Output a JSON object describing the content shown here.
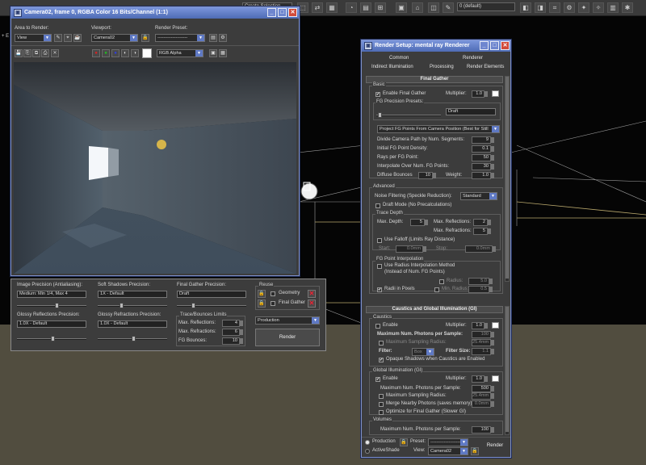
{
  "topbar": {
    "view_dropdown": "Create Selection",
    "layer_dropdown": "0 (default)"
  },
  "viewport": {
    "label": "+ E"
  },
  "frame_window": {
    "title": "Camera02, frame 0, RGBA Color 16 Bits/Channel (1:1)",
    "area_to_render_label": "Area to Render:",
    "area_to_render_value": "View",
    "viewport_label": "Viewport:",
    "viewport_value": "Camera02",
    "render_preset_label": "Render Preset:",
    "render_preset_value": "--------------------",
    "channel_value": "RGB Alpha"
  },
  "precision_panel": {
    "image_precision_label": "Image Precision (Antialiasing):",
    "image_precision_value": "Medium: Min 1/4, Max 4",
    "soft_shadows_label": "Soft Shadows Precision:",
    "soft_shadows_value": "1X - Default",
    "final_gather_label": "Final Gather Precision:",
    "final_gather_value": "Draft",
    "reuse_title": "Reuse",
    "geometry_label": "Geometry",
    "final_gather_reuse_label": "Final Gather",
    "glossy_reflections_label": "Glossy Reflections Precision:",
    "glossy_reflections_value": "1.0X - Default",
    "glossy_refractions_label": "Glossy Refractions Precision:",
    "glossy_refractions_value": "1.0X - Default",
    "trace_limits_title": "Trace/Bounces Limits",
    "max_reflections_label": "Max. Reflections:",
    "max_reflections_value": "4",
    "max_refractions_label": "Max. Refractions:",
    "max_refractions_value": "6",
    "fg_bounces_label": "FG Bounces:",
    "fg_bounces_value": "10",
    "mode_value": "Production",
    "render_button": "Render"
  },
  "render_setup": {
    "title": "Render Setup: mental ray Renderer",
    "tabs_row1": [
      "Common",
      "Renderer"
    ],
    "tabs_row2": [
      "Indirect Illumination",
      "Processing",
      "Render Elements"
    ],
    "final_gather_rollout": "Final Gather",
    "basic_title": "Basic",
    "enable_fg_label": "Enable Final Gather",
    "multiplier_label": "Multiplier:",
    "multiplier_value": "1.0",
    "fg_presets_title": "FG Precision Presets:",
    "fg_presets_value": "Draft",
    "project_points_value": "Project FG Points From Camera Position (Best for Still",
    "divide_camera_label": "Divide Camera Path by Num. Segments:",
    "divide_camera_value": "9",
    "initial_density_label": "Initial FG Point Density:",
    "initial_density_value": "0.1",
    "rays_per_point_label": "Rays per FG Point:",
    "rays_per_point_value": "50",
    "interpolate_label": "Interpolate Over Num. FG Points:",
    "interpolate_value": "30",
    "diffuse_bounces_label": "Diffuse Bounces",
    "diffuse_bounces_value": "10",
    "weight_label": "Weight:",
    "weight_value": "1.0",
    "advanced_title": "Advanced",
    "noise_filtering_label": "Noise Filtering (Speckle Reduction):",
    "noise_filtering_value": "Standard",
    "draft_mode_label": "Draft Mode (No Precalculations)",
    "trace_depth_title": "Trace Depth",
    "max_depth_label": "Max. Depth:",
    "max_depth_value": "5",
    "adv_max_reflections_label": "Max. Reflections:",
    "adv_max_reflections_value": "2",
    "adv_max_refractions_label": "Max. Refractions:",
    "adv_max_refractions_value": "5",
    "use_falloff_label": "Use Falloff (Limits Ray Distance)",
    "start_label": "Start:",
    "start_value": "0.0mm",
    "stop_label": "Stop:",
    "stop_value": "0.0mm",
    "fg_interp_title": "FG Point Interpolation",
    "use_radius_label": "Use Radius Interpolation Method",
    "use_radius_label2": "(Instead of Num. FG Points)",
    "radius_label": "Radius:",
    "radius_value": "5.0",
    "radii_pixels_label": "Radii in Pixels",
    "min_radius_label": "Min. Radius:",
    "min_radius_value": "0.5",
    "caustics_rollout": "Caustics and Global Illumination (GI)",
    "caustics_title": "Caustics",
    "caustics_enable_label": "Enable",
    "caustics_multiplier_value": "1.0",
    "caustics_photons_label": "Maximum Num. Photons per Sample:",
    "caustics_photons_value": "100",
    "caustics_radius_label": "Maximum Sampling Radius:",
    "caustics_radius_value": "25.4mm",
    "filter_label": "Filter:",
    "filter_value": "Box",
    "filter_size_label": "Filter Size:",
    "filter_size_value": "1.1",
    "opaque_shadows_label": "Opaque Shadows when Caustics are Enabled",
    "gi_title": "Global Illumination (GI)",
    "gi_enable_label": "Enable",
    "gi_multiplier_value": "1.0",
    "gi_photons_label": "Maximum Num. Photons per Sample:",
    "gi_photons_value": "500",
    "gi_radius_label": "Maximum Sampling Radius:",
    "gi_radius_value": "25.4mm",
    "merge_photons_label": "Merge Nearby Photons (saves memory):",
    "merge_photons_value": "0.0mm",
    "optimize_fg_label": "Optimize for Final Gather (Slower GI)",
    "volumes_title": "Volumes",
    "volumes_photons_label": "Maximum Num. Photons per Sample:",
    "volumes_photons_value": "100",
    "production_label": "Production",
    "activeshade_label": "ActiveShade",
    "preset_label": "Preset:",
    "preset_value": "--------------------",
    "view_label": "View:",
    "view_value": "Camera02",
    "render_button": "Render"
  }
}
